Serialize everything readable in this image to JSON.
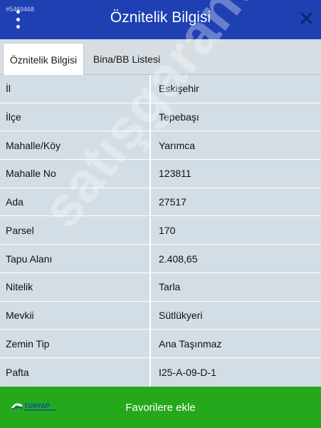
{
  "header": {
    "title": "Öznitelik Bilgisi",
    "tiny_id": "#5469468"
  },
  "tabs": [
    {
      "label": "Öznitelik Bilgisi",
      "active": true
    },
    {
      "label": "Bina/BB Listesi",
      "active": false
    }
  ],
  "rows": [
    {
      "label": "İl",
      "value": "Eskişehir"
    },
    {
      "label": "İlçe",
      "value": "Tepebaşı"
    },
    {
      "label": "Mahalle/Köy",
      "value": "Yarımca"
    },
    {
      "label": "Mahalle No",
      "value": "123811"
    },
    {
      "label": "Ada",
      "value": "27517"
    },
    {
      "label": "Parsel",
      "value": "170"
    },
    {
      "label": "Tapu Alanı",
      "value": "2.408,65"
    },
    {
      "label": "Nitelik",
      "value": "Tarla"
    },
    {
      "label": "Mevkii",
      "value": "Sütlükyeri"
    },
    {
      "label": "Zemin Tip",
      "value": "Ana Taşınmaz"
    },
    {
      "label": "Pafta",
      "value": "I25-A-09-D-1"
    }
  ],
  "watermark": "satışgaranti",
  "footer": {
    "button_label": "Favorilere ekle",
    "logo_text": "TURYAP"
  },
  "colors": {
    "header_bg": "#1e40b3",
    "footer_bg": "#25a81c",
    "table_bg": "#d3dde5"
  },
  "icons": {
    "menu": "vertical-dots-icon",
    "close": "close-x-icon",
    "logo": "turyap-logo-icon"
  }
}
